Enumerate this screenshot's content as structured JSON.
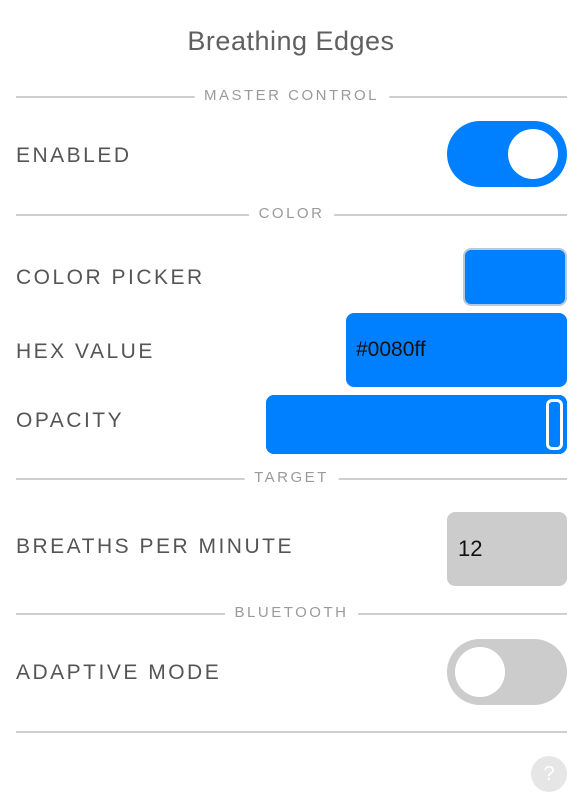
{
  "app": {
    "title": "Breathing Edges"
  },
  "sections": {
    "master_control": "MASTER CONTROL",
    "color": "COLOR",
    "target": "TARGET",
    "bluetooth": "BLUETOOTH"
  },
  "settings": {
    "enabled": {
      "label": "ENABLED",
      "state": "on"
    },
    "color_picker": {
      "label": "COLOR PICKER",
      "value": "#0080ff"
    },
    "hex_value": {
      "label": "HEX VALUE",
      "value": "#0080ff"
    },
    "opacity": {
      "label": "OPACITY",
      "value": 1.0
    },
    "breaths_per_minute": {
      "label": "BREATHS PER MINUTE",
      "value": "12"
    },
    "adaptive_mode": {
      "label": "ADAPTIVE MODE",
      "state": "off"
    }
  },
  "help": {
    "icon": "question-icon",
    "glyph": "?"
  },
  "colors": {
    "accent": "#0080ff",
    "inactive": "#cccccc",
    "divider": "#cfcfcf"
  }
}
